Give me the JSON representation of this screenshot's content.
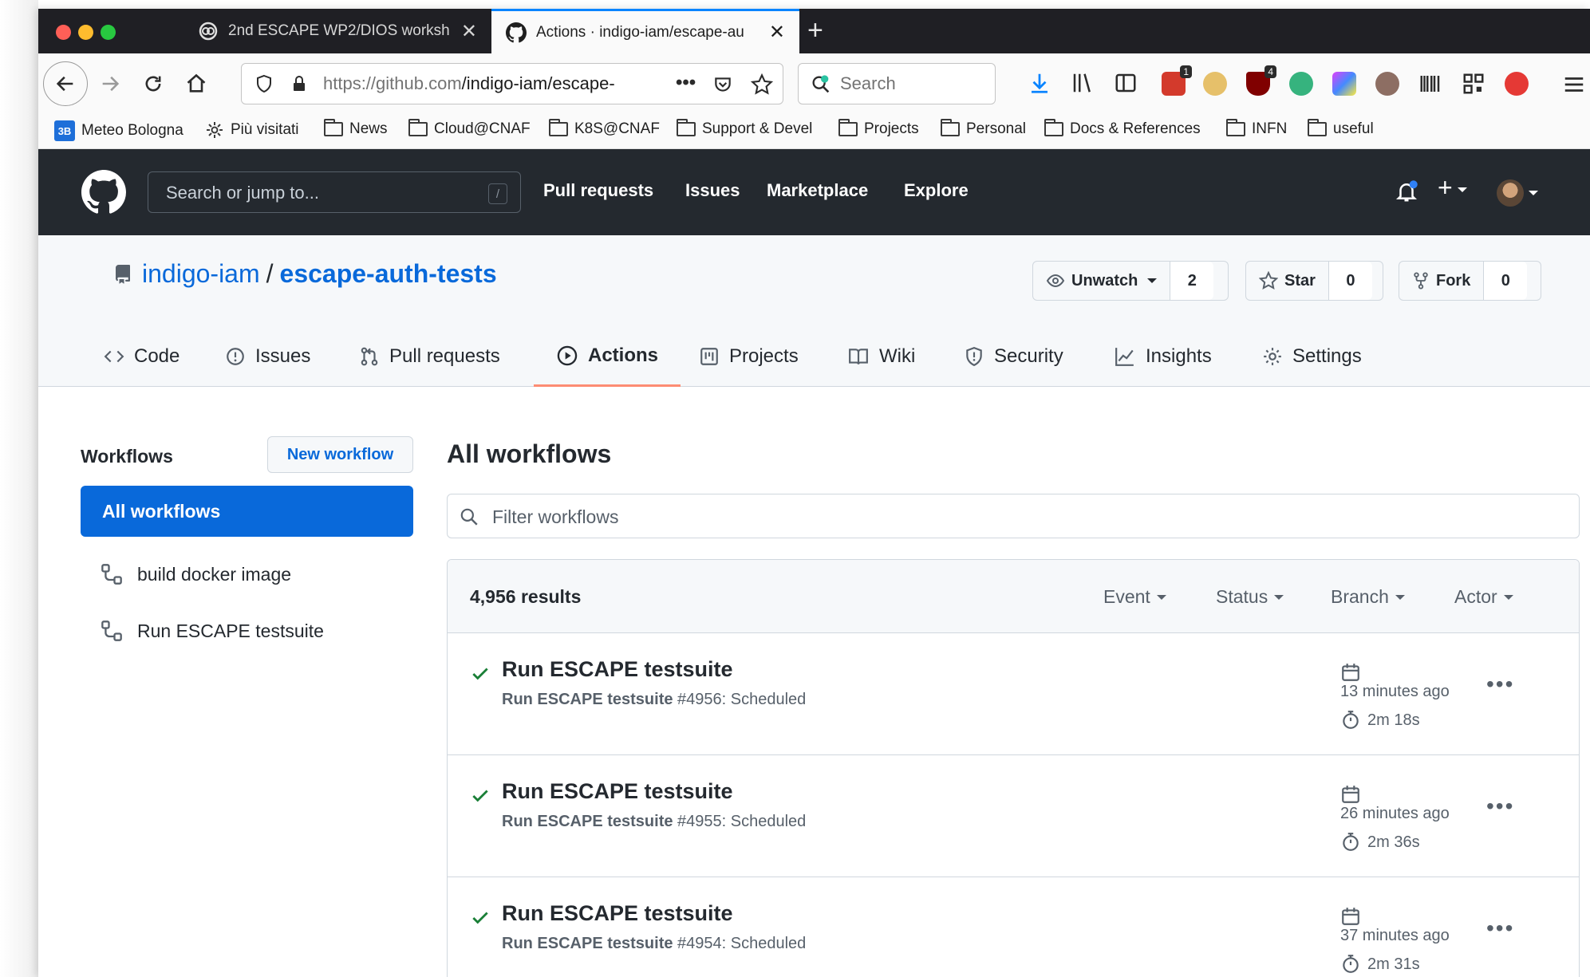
{
  "browser": {
    "tabs": [
      {
        "title": "2nd ESCAPE WP2/DIOS worksh",
        "active": false
      },
      {
        "title": "Actions · indigo-iam/escape-au",
        "active": true
      }
    ],
    "url_host": "https://github.com",
    "url_path": "/indigo-iam/escape-",
    "search_placeholder": "Search",
    "ext_badges": {
      "first": "1",
      "second": "4"
    },
    "bookmarks": [
      {
        "label": "Meteo Bologna",
        "icon": "meteo-icon"
      },
      {
        "label": "Più visitati",
        "icon": "gear-icon"
      },
      {
        "label": "News",
        "icon": "folder-icon"
      },
      {
        "label": "Cloud@CNAF",
        "icon": "folder-icon"
      },
      {
        "label": "K8S@CNAF",
        "icon": "folder-icon"
      },
      {
        "label": "Support & Devel",
        "icon": "folder-icon"
      },
      {
        "label": "Projects",
        "icon": "folder-icon"
      },
      {
        "label": "Personal",
        "icon": "folder-icon"
      },
      {
        "label": "Docs & References",
        "icon": "folder-icon"
      },
      {
        "label": "INFN",
        "icon": "folder-icon"
      },
      {
        "label": "useful",
        "icon": "folder-icon"
      }
    ]
  },
  "github": {
    "search_placeholder": "Search or jump to...",
    "search_shortcut": "/",
    "nav": [
      "Pull requests",
      "Issues",
      "Marketplace",
      "Explore"
    ]
  },
  "repo": {
    "owner": "indigo-iam",
    "name": "escape-auth-tests",
    "watch_label": "Unwatch",
    "watch_count": "2",
    "star_label": "Star",
    "star_count": "0",
    "fork_label": "Fork",
    "fork_count": "0",
    "tabs": [
      "Code",
      "Issues",
      "Pull requests",
      "Actions",
      "Projects",
      "Wiki",
      "Security",
      "Insights",
      "Settings"
    ],
    "active_tab": "Actions"
  },
  "sidebar": {
    "heading": "Workflows",
    "new_workflow": "New workflow",
    "all_workflows": "All workflows",
    "items": [
      "build docker image",
      "Run ESCAPE testsuite"
    ]
  },
  "main": {
    "title": "All workflows",
    "filter_placeholder": "Filter workflows",
    "results_count": "4,956 results",
    "filters": [
      "Event",
      "Status",
      "Branch",
      "Actor"
    ],
    "runs": [
      {
        "title": "Run ESCAPE testsuite",
        "workflow": "Run ESCAPE testsuite",
        "detail": "#4956: Scheduled",
        "when": "13 minutes ago",
        "duration": "2m 18s",
        "status": "success"
      },
      {
        "title": "Run ESCAPE testsuite",
        "workflow": "Run ESCAPE testsuite",
        "detail": "#4955: Scheduled",
        "when": "26 minutes ago",
        "duration": "2m 36s",
        "status": "success"
      },
      {
        "title": "Run ESCAPE testsuite",
        "workflow": "Run ESCAPE testsuite",
        "detail": "#4954: Scheduled",
        "when": "37 minutes ago",
        "duration": "2m 31s",
        "status": "success"
      }
    ]
  },
  "colors": {
    "accent": "#0969da",
    "success": "#1a7f37",
    "tab_underline": "#fd8c73",
    "header_bg": "#24292f"
  }
}
